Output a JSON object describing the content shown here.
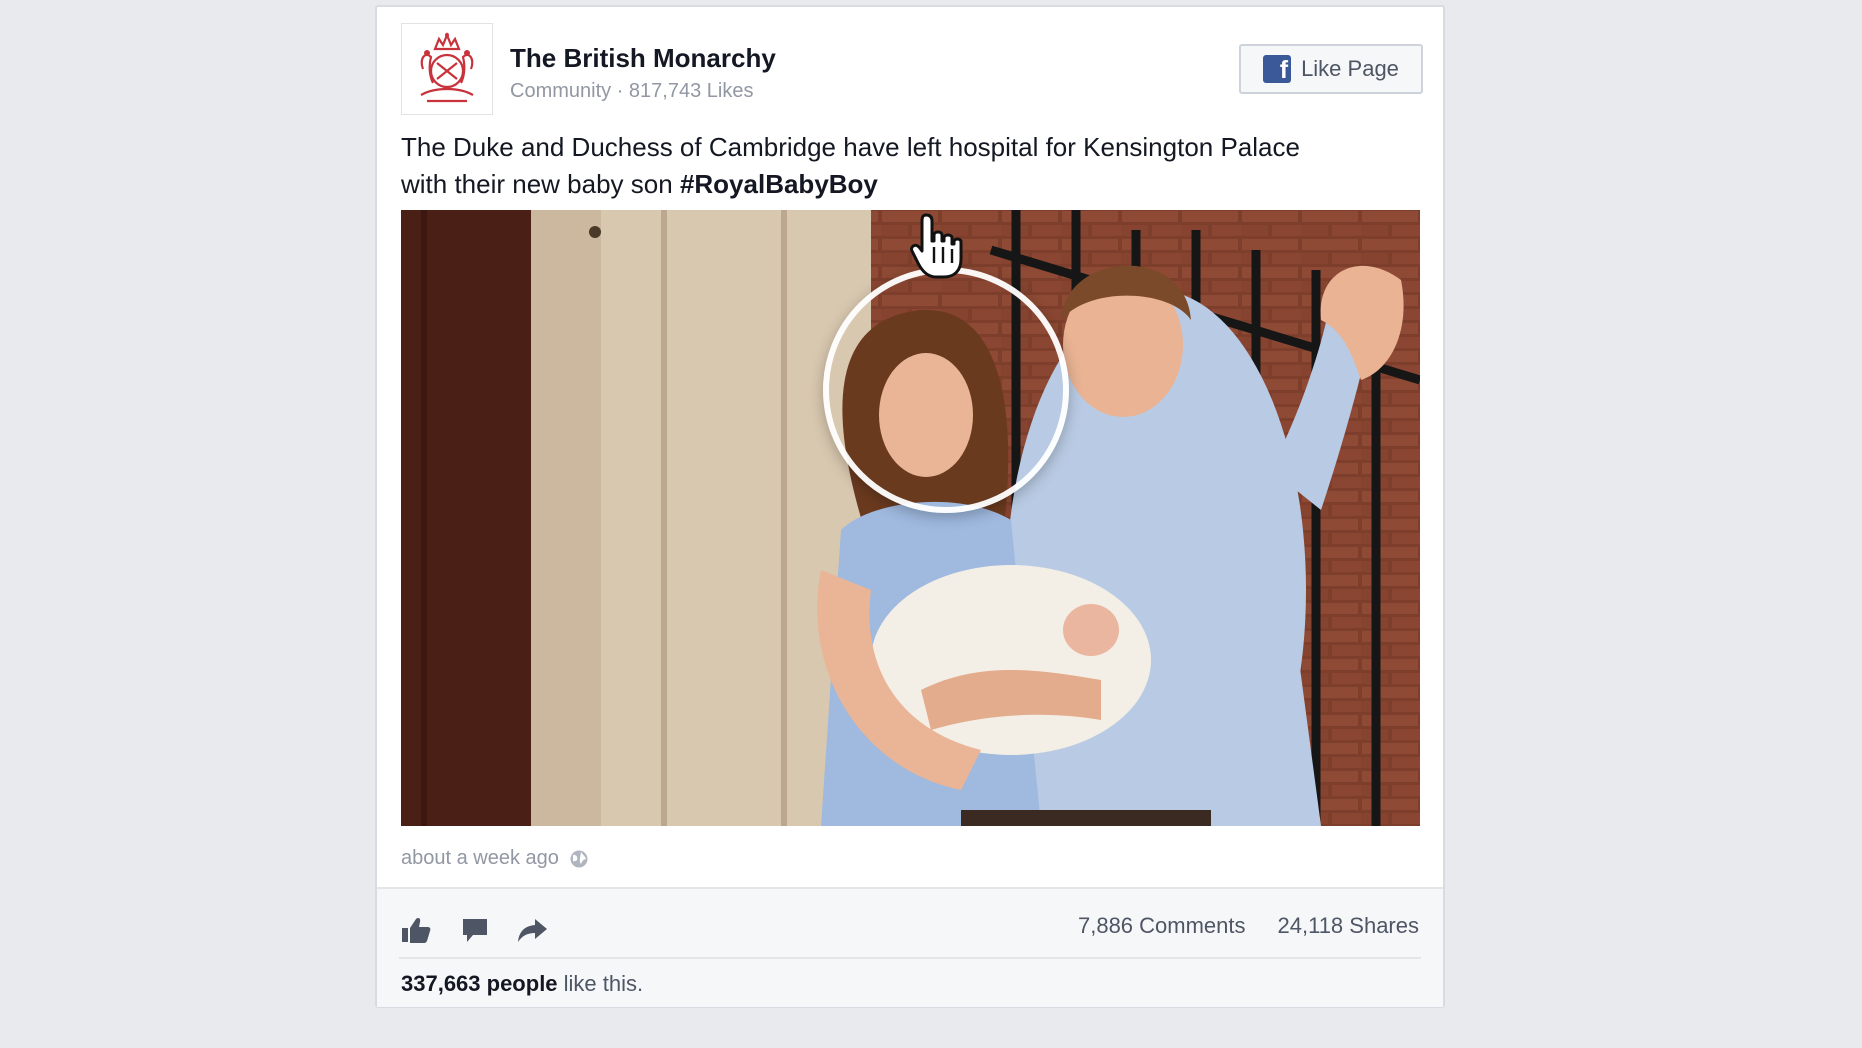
{
  "post": {
    "page_name": "The British Monarchy",
    "page_meta": "Community · 817,743 Likes",
    "like_button_label": "Like Page",
    "text_before": "The Duke and Duchess of Cambridge have left hospital for Kensington Palace with their new baby son ",
    "hashtag": "#RoyalBabyBoy",
    "timestamp": "about a week ago",
    "comments": "7,886 Comments",
    "shares": "24,118 Shares",
    "likes_count": "337,663 people",
    "likes_suffix": " like this."
  },
  "icons": {
    "like": "thumbs-up-icon",
    "comment": "comment-icon",
    "share": "share-arrow-icon",
    "privacy": "globe-icon",
    "brand": "facebook-logo-icon",
    "cursor": "hand-pointer-icon"
  },
  "colors": {
    "brand_blue": "#3b5998",
    "crest_red": "#c8323a",
    "text": "#141823",
    "meta_gray": "#9197a3"
  }
}
